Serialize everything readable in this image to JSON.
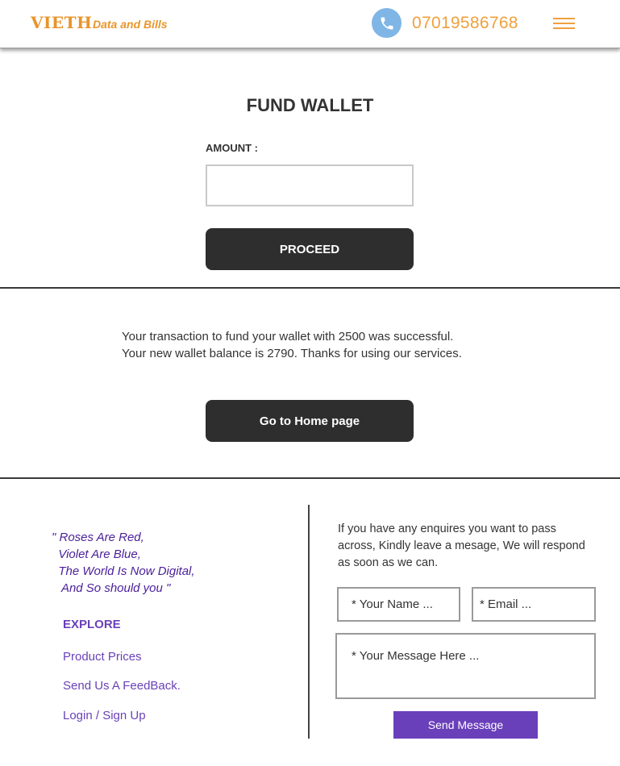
{
  "header": {
    "logo_main": "VIETH",
    "logo_sub": "Data and Bills",
    "phone_icon": "phone-icon",
    "phone_number": "07019586768",
    "menu_icon": "hamburger-menu-icon"
  },
  "fund_wallet": {
    "title": "FUND WALLET",
    "amount_label": "AMOUNT :",
    "amount_value": "",
    "proceed_label": "PROCEED"
  },
  "result": {
    "line1": "Your transaction to fund your wallet with 2500 was successful.",
    "line2": "Your new wallet balance is 2790. Thanks for using our services.",
    "home_button": "Go to Home page"
  },
  "footer": {
    "quote_lines": [
      "\" Roses Are Red,",
      "  Violet Are Blue,",
      "  The World Is Now Digital,",
      "   And So should you \""
    ],
    "explore_heading": "EXPLORE",
    "links": [
      "Product Prices",
      "Send Us A FeedBack.",
      "Login / Sign Up"
    ],
    "enquiry_text": "If you have any enquires you want to pass across, Kindly leave a mesage, We will respond as soon as we can.",
    "name_placeholder": "* Your Name ...",
    "email_placeholder": "* Email ...",
    "message_placeholder": "* Your Message Here ...",
    "send_label": "Send Message"
  },
  "colors": {
    "accent_orange": "#e8952b",
    "dark_button": "#2e2e2e",
    "purple": "#6a3fba",
    "phone_icon_bg": "#7fb6e6"
  }
}
